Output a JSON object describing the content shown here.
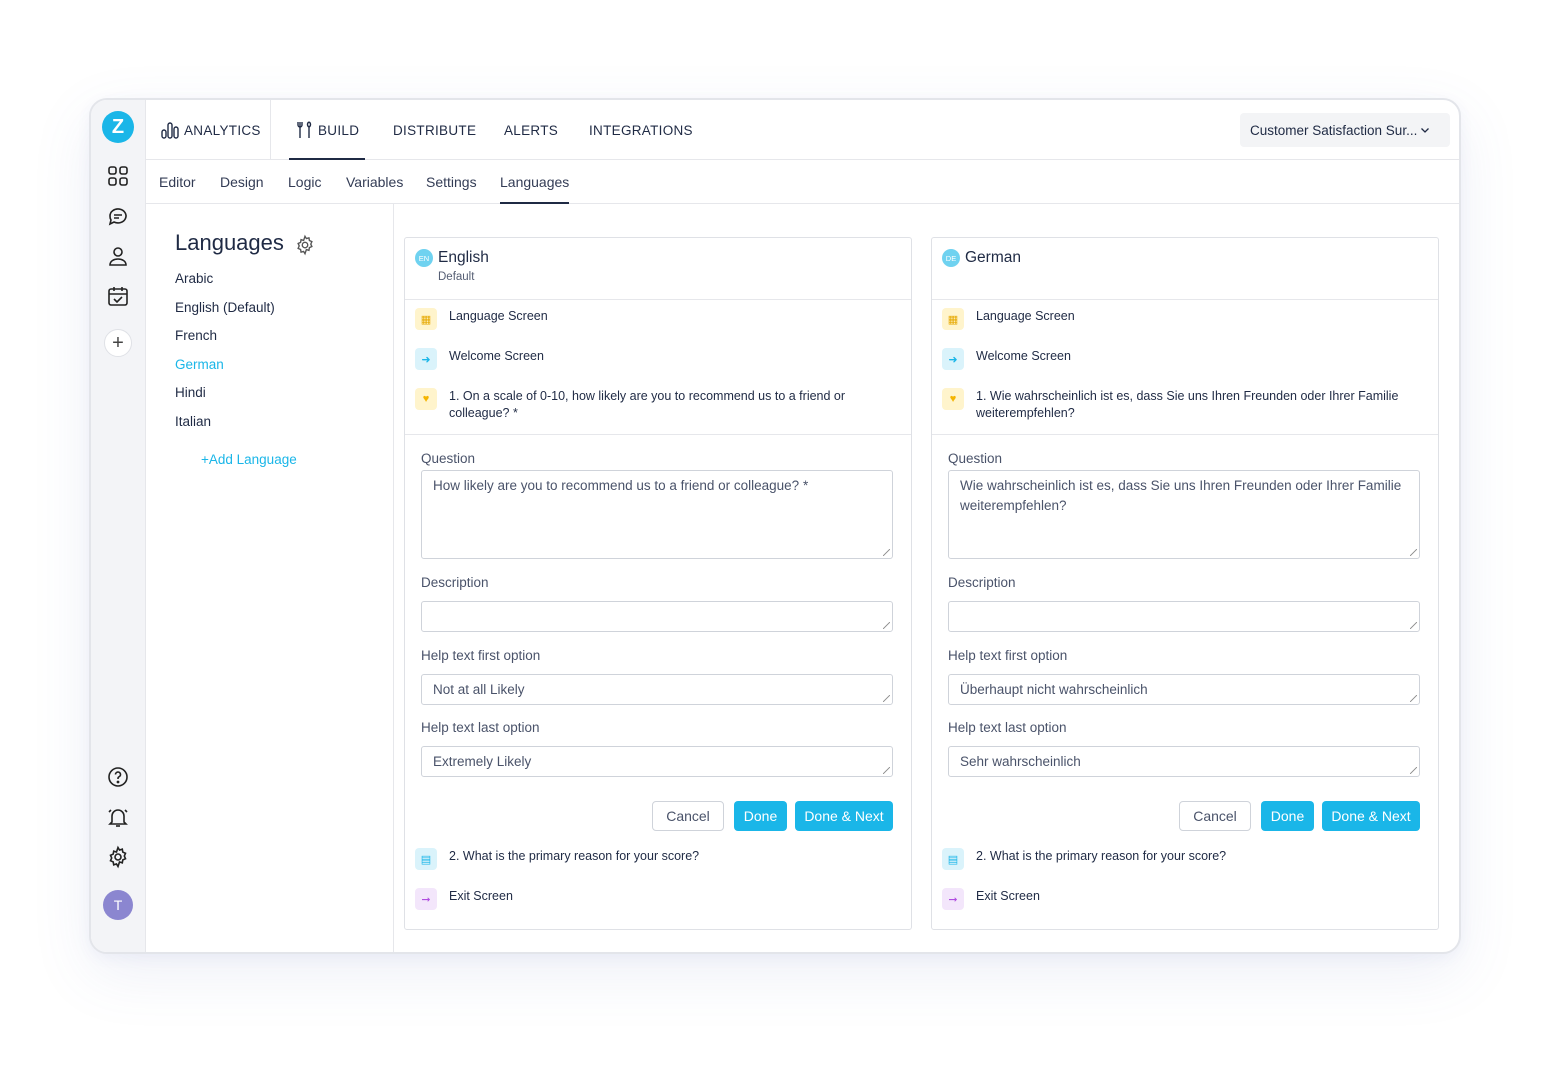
{
  "rail": {
    "logo": "Z",
    "icons": [
      "dashboard-icon",
      "chat-icon",
      "user-icon",
      "calendar-check-icon"
    ],
    "add": "+",
    "bottom_icons": [
      "help-icon",
      "bell-icon",
      "gear-icon"
    ],
    "avatar": "T"
  },
  "topnav": {
    "analytics": "ANALYTICS",
    "build": "BUILD",
    "distribute": "DISTRIBUTE",
    "alerts": "ALERTS",
    "integrations": "INTEGRATIONS",
    "survey": "Customer Satisfaction Sur...",
    "active": "BUILD"
  },
  "subtabs": [
    "Editor",
    "Design",
    "Logic",
    "Variables",
    "Settings",
    "Languages"
  ],
  "active_subtab": "Languages",
  "languages": {
    "title": "Languages",
    "items": [
      "Arabic",
      "English (Default)",
      "French",
      "German",
      "Hindi",
      "Italian"
    ],
    "selected": "German",
    "add": "+Add Language"
  },
  "colors": {
    "accent": "#1ab6e8",
    "text": "#1f2a44"
  },
  "cards": [
    {
      "code": "EN",
      "name": "English",
      "sub": "Default",
      "items": {
        "language_screen": "Language Screen",
        "welcome_screen": "Welcome Screen",
        "q1": "1. On a scale of 0-10, how likely are you to recommend us to a friend or colleague? *",
        "q2": "2. What is the primary reason for your score?",
        "exit_screen": "Exit Screen"
      },
      "form": {
        "question_label": "Question",
        "question": "How likely are you to recommend us to a friend or colleague? *",
        "description_label": "Description",
        "description": "",
        "help_first_label": "Help text first option",
        "help_first": "Not at all Likely",
        "help_last_label": "Help text last option",
        "help_last": "Extremely Likely"
      },
      "buttons": {
        "cancel": "Cancel",
        "done": "Done",
        "done_next": "Done & Next"
      }
    },
    {
      "code": "DE",
      "name": "German",
      "sub": "",
      "items": {
        "language_screen": "Language Screen",
        "welcome_screen": "Welcome Screen",
        "q1": "1. Wie wahrscheinlich ist es, dass Sie uns Ihren Freunden oder Ihrer Familie weiterempfehlen?",
        "q2": "2. What is the primary reason for your score?",
        "exit_screen": "Exit Screen"
      },
      "form": {
        "question_label": "Question",
        "question": "Wie wahrscheinlich ist es, dass Sie uns Ihren Freunden oder Ihrer Familie weiterempfehlen?",
        "description_label": "Description",
        "description": "",
        "help_first_label": "Help text first option",
        "help_first": "Überhaupt nicht wahrscheinlich",
        "help_last_label": "Help text last option",
        "help_last": "Sehr wahrscheinlich"
      },
      "buttons": {
        "cancel": "Cancel",
        "done": "Done",
        "done_next": "Done & Next"
      }
    }
  ]
}
